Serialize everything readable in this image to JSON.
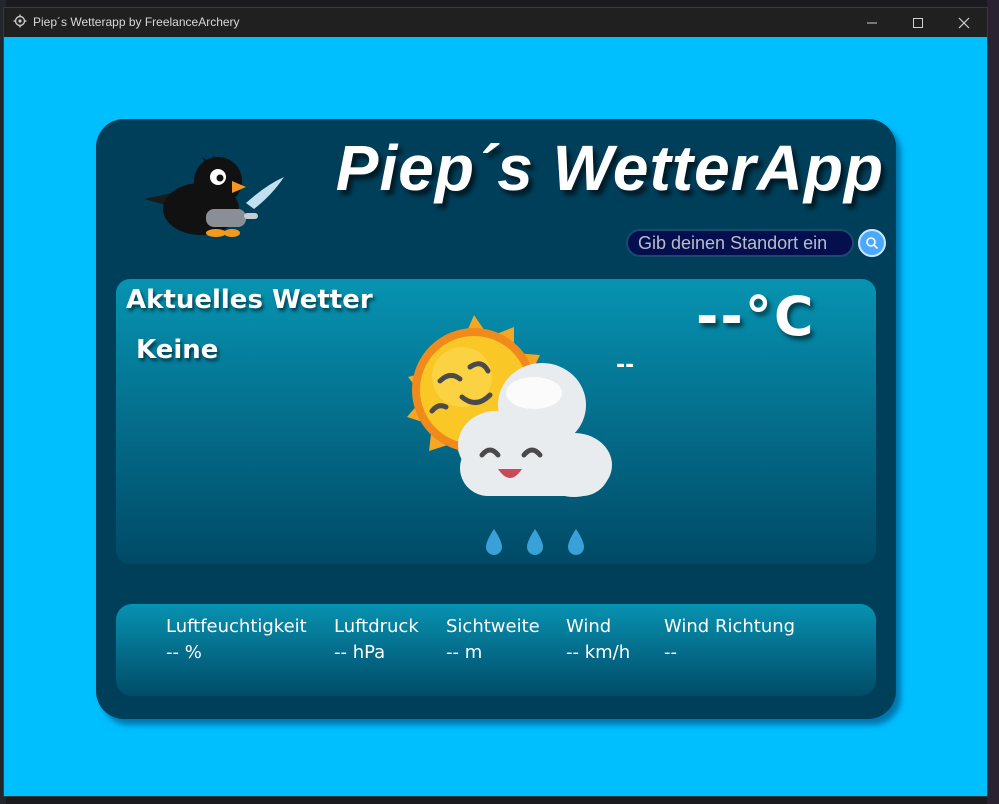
{
  "window": {
    "title": "Piep´s Wetterapp by FreelanceArchery"
  },
  "header": {
    "app_title": "Piep´s WetterApp"
  },
  "search": {
    "placeholder": "Gib deinen Standort ein"
  },
  "current": {
    "title": "Aktuelles Wetter",
    "location": "Keine",
    "temperature": "--°C",
    "condition": "--",
    "icon": "sun-cloud-rain-icon"
  },
  "details": [
    {
      "label": "Luftfeuchtigkeit",
      "value": "-- %"
    },
    {
      "label": "Luftdruck",
      "value": "-- hPa"
    },
    {
      "label": "Sichtweite",
      "value": "-- m"
    },
    {
      "label": "Wind",
      "value": "-- km/h"
    },
    {
      "label": "Wind Richtung",
      "value": "--"
    }
  ],
  "colors": {
    "window_bg": "#00bfff",
    "card_bg": "#003f5a",
    "panel_top": "#0694b2",
    "search_bg": "#050f4e",
    "search_button": "#4aa8ff"
  }
}
